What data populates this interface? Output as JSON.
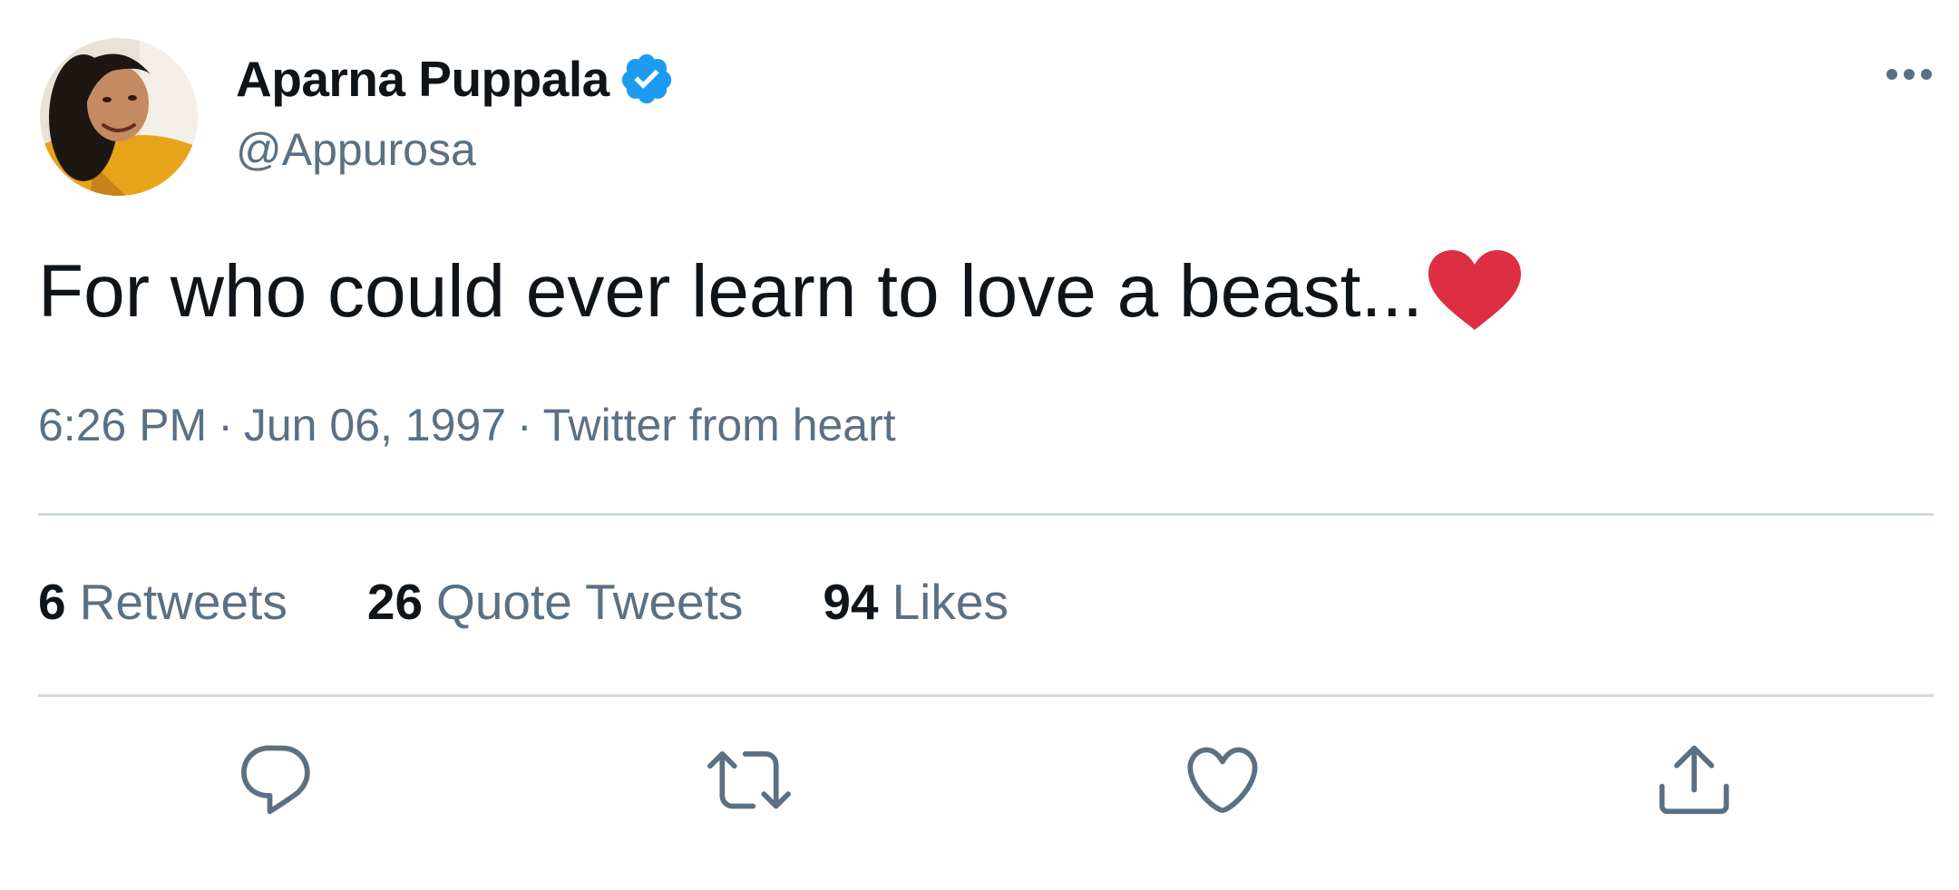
{
  "author": {
    "display_name": "Aparna Puppala",
    "handle": "@Appurosa",
    "verified": true,
    "avatar_icon": "avatar-photo"
  },
  "tweet": {
    "text": "For who could ever learn to love a beast...",
    "emoji": "red-heart-emoji"
  },
  "meta": {
    "time": "6:26 PM",
    "separator": "·",
    "date": "Jun 06, 1997",
    "source": "Twitter from heart"
  },
  "stats": {
    "retweets": {
      "count": "6",
      "label": "Retweets"
    },
    "quote_tweets": {
      "count": "26",
      "label": "Quote Tweets"
    },
    "likes": {
      "count": "94",
      "label": "Likes"
    }
  },
  "actions": [
    {
      "name": "reply",
      "icon": "reply-icon"
    },
    {
      "name": "retweet",
      "icon": "retweet-icon"
    },
    {
      "name": "like",
      "icon": "heart-icon"
    },
    {
      "name": "share",
      "icon": "share-icon"
    }
  ],
  "colors": {
    "primary_text": "#0f1419",
    "secondary_text": "#5b7083",
    "verified_blue": "#1d9bf0",
    "divider": "#cfd9de",
    "heart_red": "#dd2e44"
  }
}
